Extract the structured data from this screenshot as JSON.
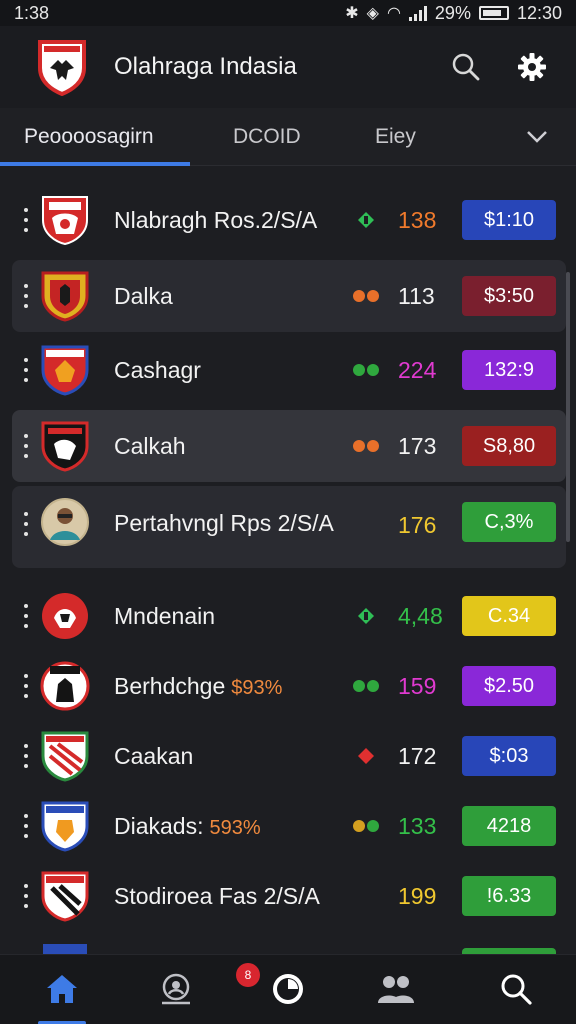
{
  "status": {
    "time": "1:38",
    "battery": "29%",
    "clock": "12:30"
  },
  "app": {
    "title": "Olahraga Indasia"
  },
  "tabs": [
    {
      "label": "Peoooosagirn",
      "active": true
    },
    {
      "label": "DCOID",
      "active": false
    },
    {
      "label": "Eiey",
      "active": false
    }
  ],
  "rows": [
    {
      "name": "Nlabragh Ros.2/S/A",
      "tag": "",
      "trend": "up",
      "score": "138",
      "pill": "$1:10"
    },
    {
      "name": "Dalka",
      "tag": "",
      "trend": "pair",
      "score": "113",
      "pill": "$3:50"
    },
    {
      "name": "Cashagr",
      "tag": "",
      "trend": "pair",
      "score": "224",
      "pill": "132:9"
    },
    {
      "name": "Calkah",
      "tag": "",
      "trend": "pair",
      "score": "173",
      "pill": "S8,80"
    },
    {
      "name": "Pertahvngl Rps 2/S/A",
      "tag": "",
      "trend": "none",
      "score": "176",
      "pill": "C,3%"
    },
    {
      "name": "Mndenain",
      "tag": "",
      "trend": "up",
      "score": "4,48",
      "pill": "C.34"
    },
    {
      "name": "Berhdchge",
      "tag": "$93%",
      "trend": "pair",
      "score": "159",
      "pill": "$2.50"
    },
    {
      "name": "Caakan",
      "tag": "",
      "trend": "down",
      "score": "172",
      "pill": "$:03"
    },
    {
      "name": "Diakads:",
      "tag": "593%",
      "trend": "pair",
      "score": "133",
      "pill": "4218"
    },
    {
      "name": "Stodiroea Fas 2/S/A",
      "tag": "",
      "trend": "none",
      "score": "199",
      "pill": "!6.33"
    }
  ],
  "badge": {
    "label": "8"
  },
  "colors": {
    "accent": "#3e7be6",
    "score_orange": "#f07a2c",
    "score_white": "#f2f2f2",
    "score_magenta": "#e03ad0",
    "score_yellow": "#f0c830",
    "score_green": "#34c04a",
    "pill_blue": "#2846b8",
    "pill_maroon": "#7a1f2e",
    "pill_purple": "#8a28d8",
    "pill_red": "#9a2020",
    "pill_green": "#2f9e3a",
    "pill_yellow": "#e2c61a"
  },
  "icons": {
    "app_logo": "eagle-shield-icon",
    "search": "search-icon",
    "settings": "gear-icon",
    "chevron": "chevron-down-icon",
    "nav_home": "home-icon",
    "nav_scout": "target-person-icon",
    "nav_clock": "clock-icon",
    "nav_team": "people-icon",
    "nav_search": "search-icon"
  }
}
